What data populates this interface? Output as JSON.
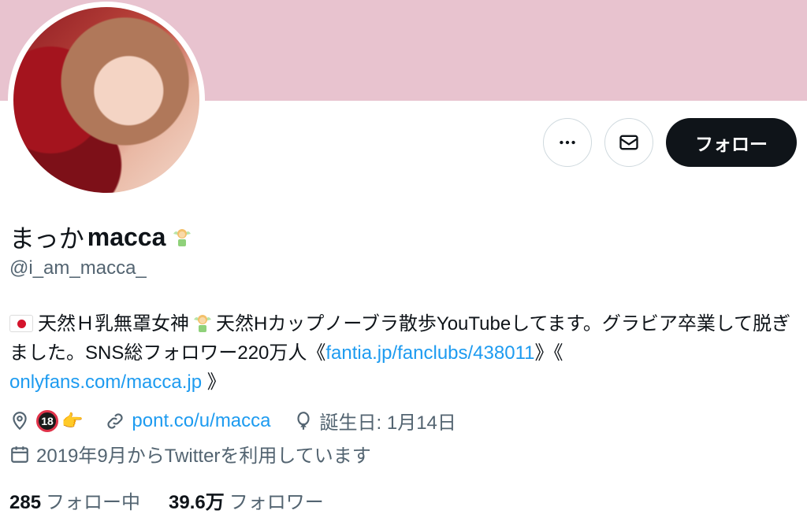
{
  "profile": {
    "display_name_jp": "まっか",
    "display_name_en": "macca",
    "handle": "@i_am_macca_"
  },
  "actions": {
    "more_icon": "more-horizontal-icon",
    "message_icon": "envelope-icon",
    "follow_label": "フォロー"
  },
  "bio": {
    "part1": "天然Ｈ乳無罩女神",
    "part2": "天然Hカップノーブラ散歩YouTubeしてます。グラビア卒業して脱ぎました。SNS総フォロワー220万人《",
    "link1": "fantia.jp/fanclubs/438011",
    "part3": "》《",
    "link2": "onlyfans.com/macca.jp",
    "part4": "》"
  },
  "meta": {
    "location_badge": "18",
    "location_pointer": "👉",
    "website": "pont.co/u/macca",
    "birthday": "誕生日: 1月14日",
    "joined": "2019年9月からTwitterを利用しています"
  },
  "stats": {
    "following_count": "285",
    "following_label": "フォロー中",
    "followers_count": "39.6万",
    "followers_label": "フォロワー"
  },
  "colors": {
    "banner": "#e8c3cf",
    "link": "#1d9bf0",
    "follow_button": "#0f1419",
    "muted_text": "#536471"
  }
}
